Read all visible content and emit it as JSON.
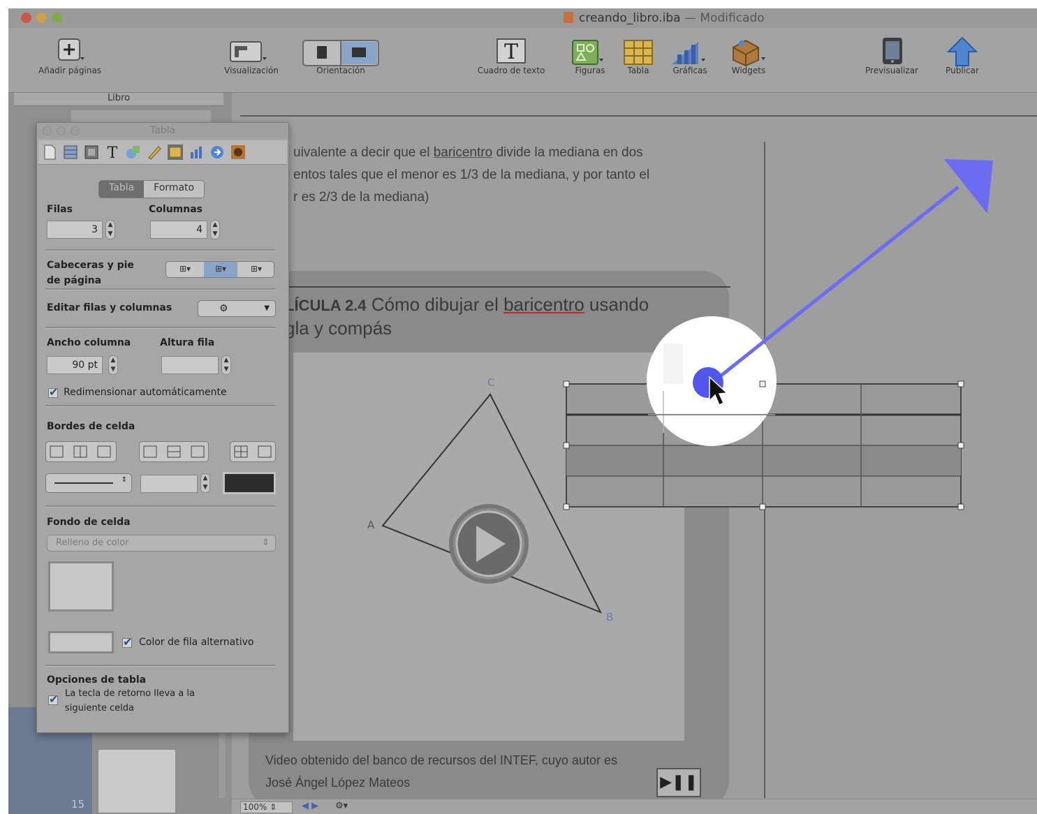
{
  "window": {
    "title": "creando_libro.iba",
    "title_separator": "—",
    "status": "Modificado"
  },
  "toolbar": {
    "add_pages": "Añadir páginas",
    "view": "Visualización",
    "orientation": "Orientación",
    "text_box": "Cuadro de texto",
    "shapes": "Figuras",
    "table": "Tabla",
    "charts": "Gráficas",
    "widgets": "Widgets",
    "preview": "Previsualizar",
    "publish": "Publicar"
  },
  "sidebar": {
    "header": "Libro",
    "page_number": "15"
  },
  "status_bar": {
    "zoom": "100%"
  },
  "document": {
    "paragraph_lines": [
      "uivalente a decir que el ",
      "entos tales que el menor es 1/3 de la mediana, y por tanto el",
      "r es 2/3 de la mediana)"
    ],
    "term": "baricentro",
    "paragraph_line1_suffix": " divide la mediana en dos",
    "widget_label": "LÍCULA 2.4",
    "widget_title_rest": " Cómo dibujar el ",
    "widget_title_suffix": " usando",
    "widget_title_line2": "gla y compás",
    "triangle_labels": {
      "a": "A",
      "b": "B",
      "c": "C"
    },
    "caption_line1": "Video obtenido del banco de recursos del INTEF, cuyo autor  es",
    "caption_line2": "José Ángel López Mateos"
  },
  "inspector": {
    "title": "Tabla",
    "seg_table": "Tabla",
    "seg_format": "Formato",
    "rows_label": "Filas",
    "rows_value": "3",
    "columns_label": "Columnas",
    "columns_value": "4",
    "headers_label_1": "Cabeceras y pie",
    "headers_label_2": "de página",
    "edit_label": "Editar filas y columnas",
    "col_width_label": "Ancho columna",
    "col_width_value": "90 pt",
    "row_height_label": "Altura fila",
    "row_height_value": "",
    "autosize_label": "Redimensionar automáticamente",
    "autosize_checked": true,
    "borders_label": "Bordes de celda",
    "background_label": "Fondo de celda",
    "fill_select": "Relleno de color",
    "alt_row_label": "Color de fila alternativo",
    "alt_row_checked": true,
    "options_label": "Opciones de tabla",
    "return_label_1": "La tecla de retorno lleva a la",
    "return_label_2": "siguiente celda",
    "return_checked": true
  },
  "table": {
    "rows": 3,
    "columns": 4
  },
  "colors": {
    "arrow": "#6a6cf2",
    "highlight": "#ffffff"
  }
}
